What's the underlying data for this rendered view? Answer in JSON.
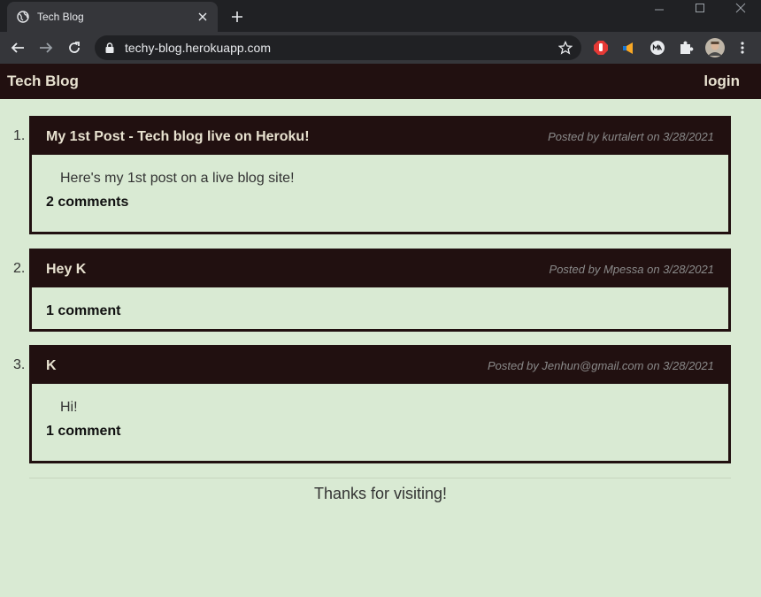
{
  "browser": {
    "tab_title": "Tech Blog",
    "url": "techy-blog.herokuapp.com"
  },
  "site": {
    "title": "Tech Blog",
    "login_label": "login"
  },
  "posts": [
    {
      "number": "1.",
      "title": "My 1st Post - Tech blog live on Heroku!",
      "meta": "Posted by kurtalert on 3/28/2021",
      "body": "Here's my 1st post on a live blog site!",
      "comments": "2 comments"
    },
    {
      "number": "2.",
      "title": "Hey K",
      "meta": "Posted by Mpessa on 3/28/2021",
      "body": "",
      "comments": "1 comment"
    },
    {
      "number": "3.",
      "title": "K",
      "meta": "Posted by Jenhun@gmail.com on 3/28/2021",
      "body": "Hi!",
      "comments": "1 comment"
    }
  ],
  "footer": {
    "text": "Thanks for visiting!"
  },
  "colors": {
    "header_bg": "#211010",
    "page_bg": "#d9ead3",
    "header_text": "#e8e2d0"
  }
}
